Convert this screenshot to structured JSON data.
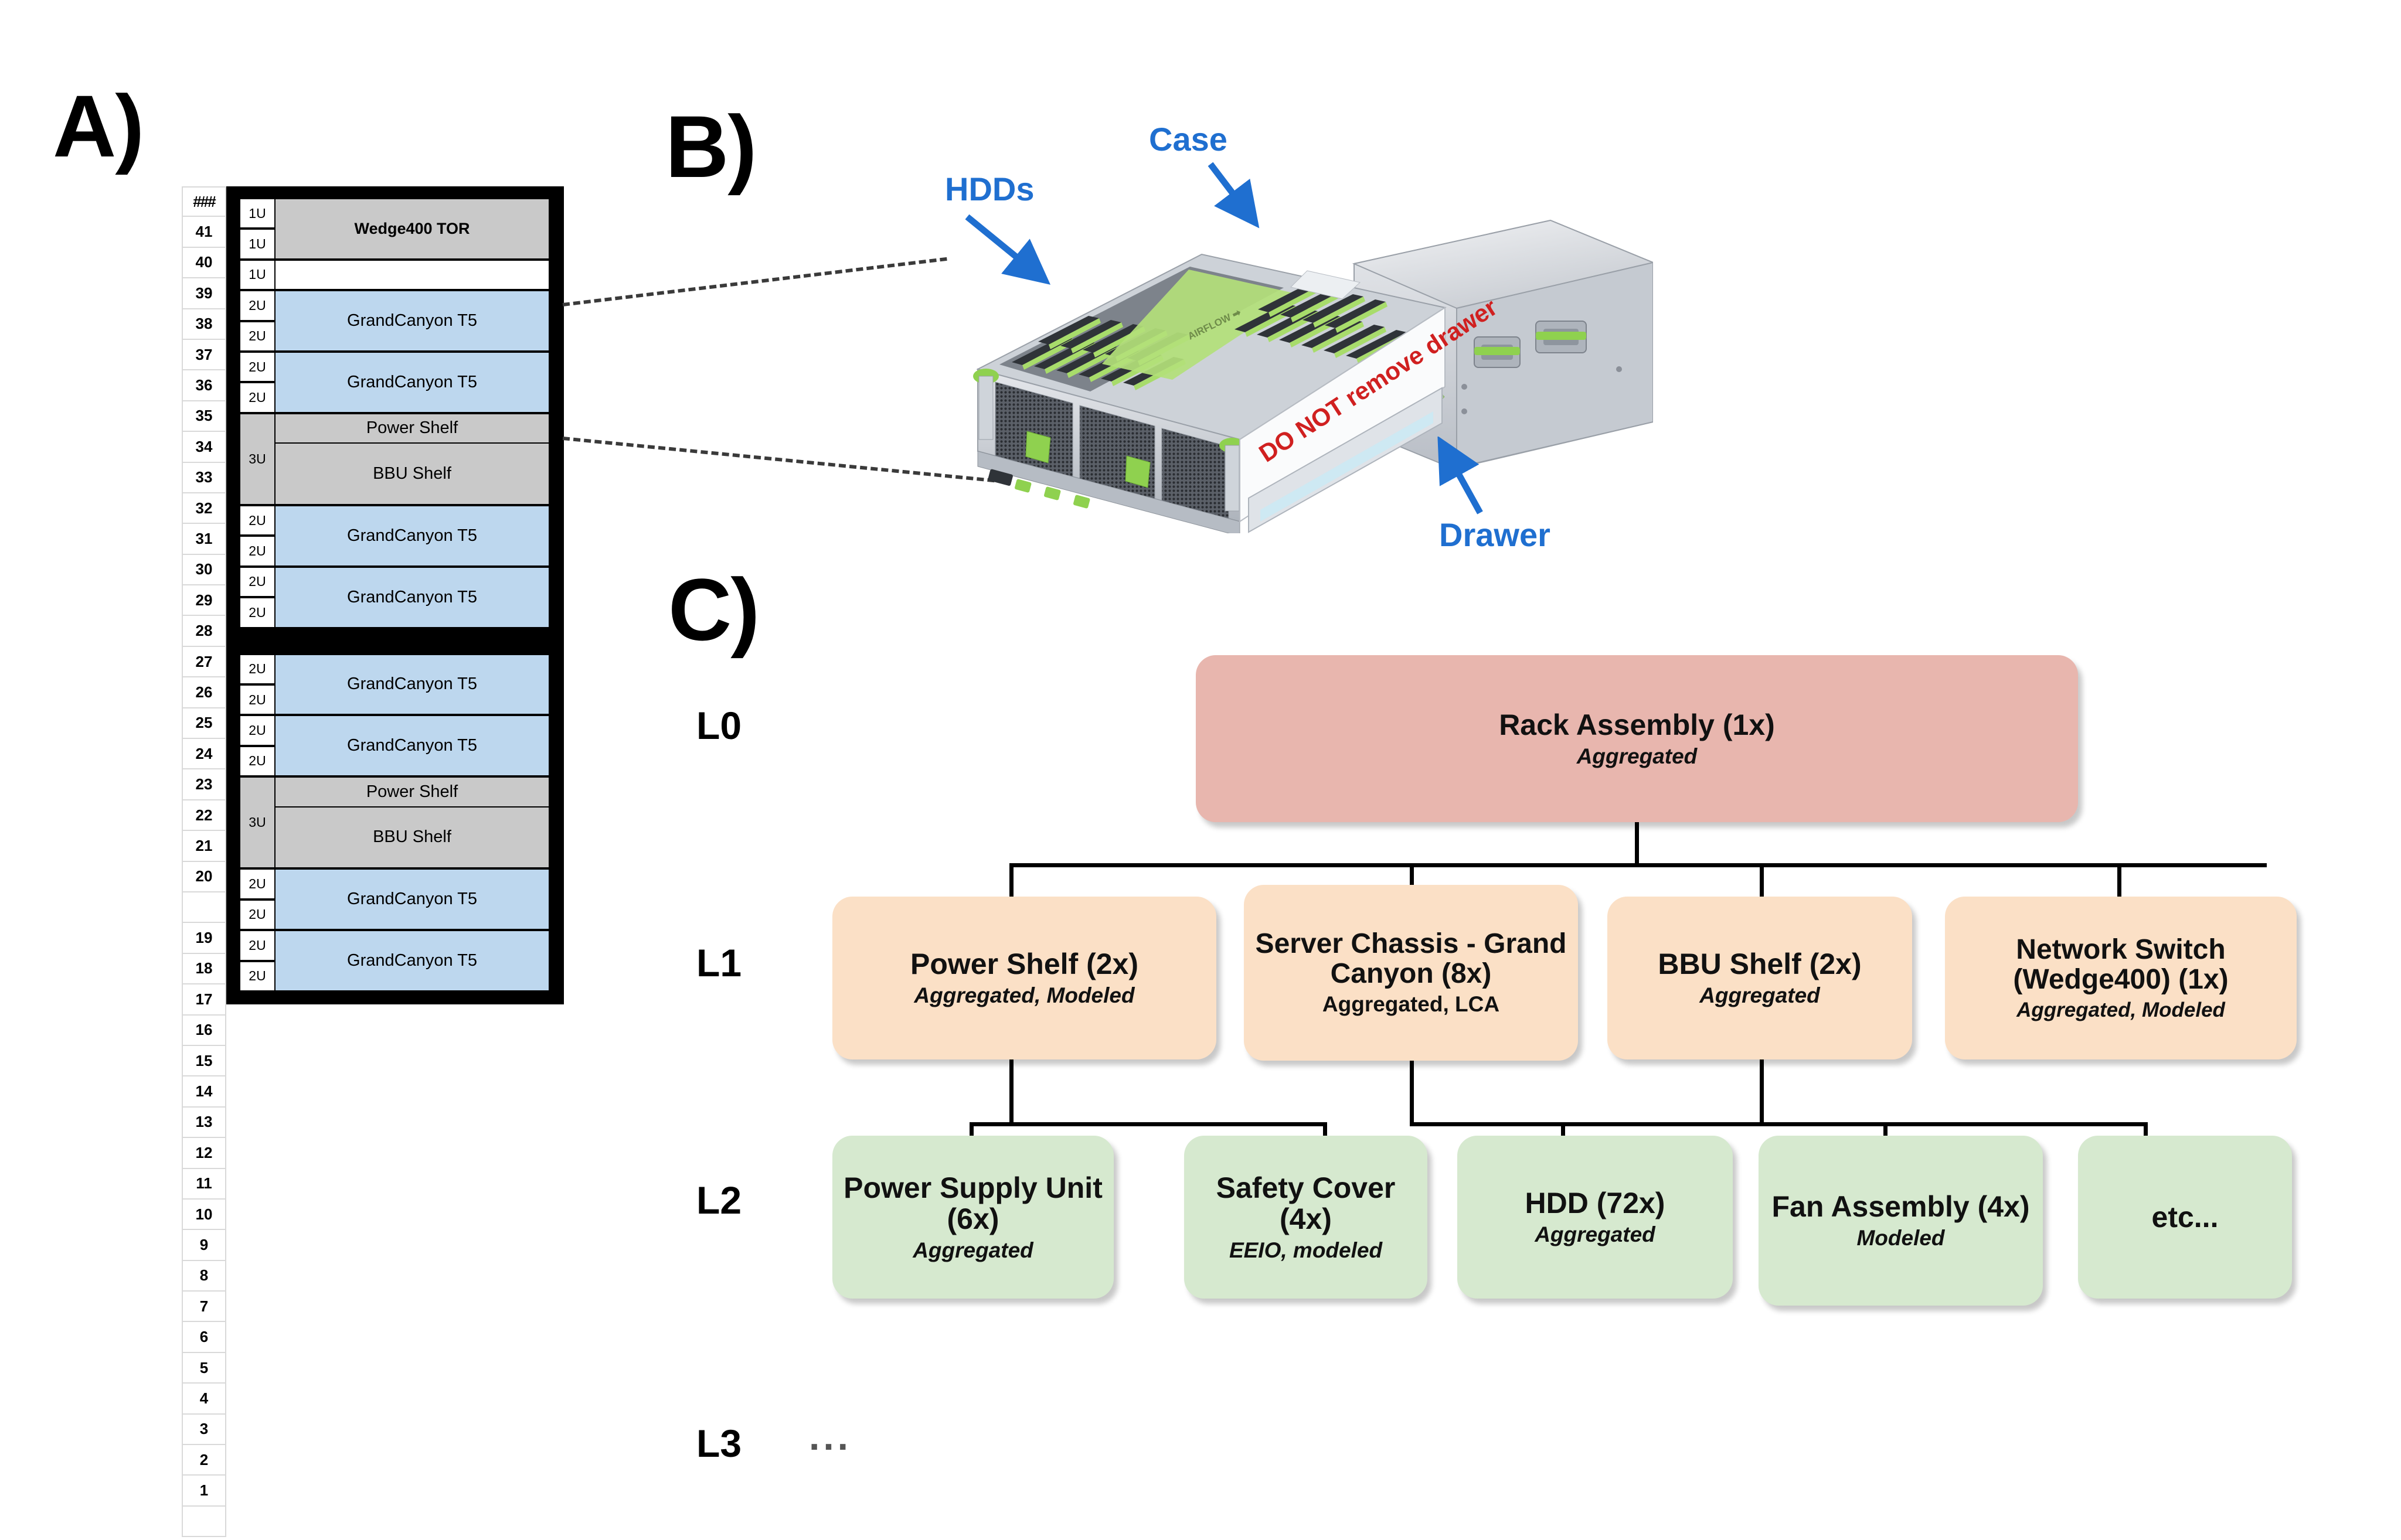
{
  "panels": {
    "a_label": "A)",
    "b_label": "B)",
    "c_label": "C)"
  },
  "rack": {
    "ruler_header": "###",
    "units_top_to_bottom": [
      41,
      40,
      39,
      38,
      37,
      36,
      35,
      34,
      33,
      32,
      31,
      30,
      29,
      28,
      27,
      26,
      25,
      24,
      23,
      22,
      21,
      20,
      "",
      19,
      18,
      17,
      16,
      15,
      14,
      13,
      12,
      11,
      10,
      9,
      8,
      7,
      6,
      5,
      4,
      3,
      2,
      1
    ],
    "sections": [
      {
        "name": "upper-section",
        "slots": [
          {
            "type": "single",
            "u": "1U",
            "label": "Wedge400 TOR",
            "fill": "grey",
            "rows": 1,
            "label_rows": 2
          },
          {
            "type": "single",
            "u": "1U",
            "label": "",
            "fill": "grey",
            "rows": 1
          },
          {
            "type": "single",
            "u": "1U",
            "label": "",
            "fill": "white",
            "rows": 1
          },
          {
            "type": "group",
            "us": [
              "2U",
              "2U"
            ],
            "label": "GrandCanyon T5",
            "fill": "blue"
          },
          {
            "type": "group",
            "us": [
              "2U",
              "2U"
            ],
            "label": "GrandCanyon T5",
            "fill": "blue"
          },
          {
            "type": "powerbbu",
            "u": "3U",
            "top_label": "Power Shelf",
            "bottom_label": "BBU Shelf"
          },
          {
            "type": "group",
            "us": [
              "2U",
              "2U"
            ],
            "label": "GrandCanyon T5",
            "fill": "blue"
          },
          {
            "type": "group",
            "us": [
              "2U",
              "2U"
            ],
            "label": "GrandCanyon T5",
            "fill": "blue"
          }
        ]
      },
      {
        "name": "lower-section",
        "slots": [
          {
            "type": "group",
            "us": [
              "2U",
              "2U"
            ],
            "label": "GrandCanyon T5",
            "fill": "blue"
          },
          {
            "type": "group",
            "us": [
              "2U",
              "2U"
            ],
            "label": "GrandCanyon T5",
            "fill": "blue"
          },
          {
            "type": "powerbbu",
            "u": "3U",
            "top_label": "Power Shelf",
            "bottom_label": "BBU Shelf"
          },
          {
            "type": "group",
            "us": [
              "2U",
              "2U"
            ],
            "label": "GrandCanyon T5",
            "fill": "blue"
          },
          {
            "type": "group",
            "us": [
              "2U",
              "2U"
            ],
            "label": "GrandCanyon T5",
            "fill": "blue"
          }
        ]
      }
    ]
  },
  "photo": {
    "callouts": [
      {
        "id": "hdds",
        "text": "HDDs"
      },
      {
        "id": "case",
        "text": "Case"
      },
      {
        "id": "drawer",
        "text": "Drawer"
      }
    ],
    "chassis_warning": "DO NOT remove drawer",
    "airflow_label": "AIRFLOW"
  },
  "tree": {
    "levels": [
      {
        "id": "L0",
        "label": "L0"
      },
      {
        "id": "L1",
        "label": "L1"
      },
      {
        "id": "L2",
        "label": "L2"
      },
      {
        "id": "L3",
        "label": "L3"
      }
    ],
    "l3_ellipsis": "...",
    "nodes": {
      "l0": [
        {
          "title": "Rack Assembly (1x)",
          "sub": "Aggregated"
        }
      ],
      "l1": [
        {
          "title": "Power Shelf (2x)",
          "sub": "Aggregated, Modeled"
        },
        {
          "title": "Server Chassis - Grand Canyon (8x)",
          "sub": "Aggregated, LCA"
        },
        {
          "title": "BBU Shelf (2x)",
          "sub": "Aggregated"
        },
        {
          "title": "Network Switch (Wedge400) (1x)",
          "sub": "Aggregated, Modeled"
        }
      ],
      "l2": [
        {
          "title": "Power Supply Unit (6x)",
          "sub": "Aggregated"
        },
        {
          "title": "Safety Cover (4x)",
          "sub": "EEIO, modeled"
        },
        {
          "title": "HDD (72x)",
          "sub": "Aggregated"
        },
        {
          "title": "Fan Assembly (4x)",
          "sub": "Modeled"
        },
        {
          "title": "etc...",
          "sub": ""
        }
      ]
    }
  },
  "colors": {
    "l0_fill": "#e8b6ae",
    "l1_fill": "#fbe0c6",
    "l2_fill": "#d6e9cf",
    "server_fill": "#bdd7ee",
    "shelf_fill": "#c9c9c9",
    "callout_blue": "#1f6fd0",
    "warning_red": "#d02020"
  }
}
